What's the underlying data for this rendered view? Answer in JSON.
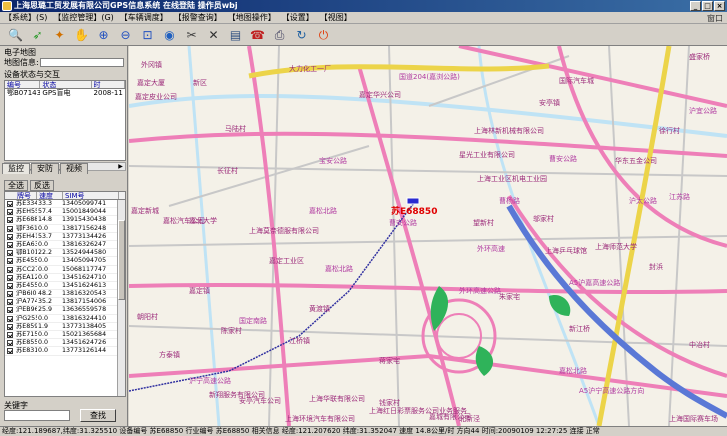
{
  "window": {
    "title": "上海思璐工贸发展有限公司GPS信息系统    在线登陆   操作员wbj"
  },
  "menu": [
    "【系统】(S)",
    "【监控管理】(G)",
    "【车辆调度】",
    "【报警查询】",
    "【地图操作】",
    "【设置】",
    "【视图】"
  ],
  "menu_right": "窗口",
  "toolbar": [
    {
      "icon": "search-icon",
      "glyph": "🔍"
    },
    {
      "icon": "pointer-icon",
      "glyph": "➶"
    },
    {
      "icon": "wand-icon",
      "glyph": "✦"
    },
    {
      "icon": "hand-icon",
      "glyph": "✋"
    },
    {
      "icon": "zoom-in-icon",
      "glyph": "⊕"
    },
    {
      "icon": "zoom-out-icon",
      "glyph": "⊖"
    },
    {
      "icon": "zoom-rect-icon",
      "glyph": "⊡"
    },
    {
      "icon": "globe-icon",
      "glyph": "◉"
    },
    {
      "icon": "measure-icon",
      "glyph": "✂"
    },
    {
      "icon": "satellite-icon",
      "glyph": "✕"
    },
    {
      "icon": "report-icon",
      "glyph": "▤"
    },
    {
      "icon": "phone-icon",
      "glyph": "☎"
    },
    {
      "icon": "printer-icon",
      "glyph": "⎙"
    },
    {
      "icon": "refresh-icon",
      "glyph": "↻"
    },
    {
      "icon": "exit-icon",
      "glyph": "⏻"
    }
  ],
  "left": {
    "e_map_label": "电子地图",
    "map_info_label": "地图信息:",
    "device_status_label": "设备状态与交互",
    "device_grid": {
      "headers": [
        "编号",
        "状态",
        "时"
      ],
      "rows": [
        [
          "鄂B07143",
          "GPS盲电",
          "2008-11"
        ]
      ]
    },
    "tabs": [
      "监控",
      "安防",
      "视频"
    ],
    "subtabs": [
      "全选",
      "反选"
    ],
    "vehicle_grid": {
      "headers": [
        "牌号",
        "速度",
        "SIM号"
      ],
      "rows": [
        [
          "苏E33436",
          "33.3",
          "13405099741"
        ],
        [
          "苏EH5549",
          "57.4",
          "15001849044"
        ],
        [
          "苏E68850",
          "14.8",
          "13915430438"
        ],
        [
          "鄂F36141",
          "0.0",
          "13817156248"
        ],
        [
          "苏EH4177",
          "53.7",
          "13773134426"
        ],
        [
          "苏EA6357",
          "0.0",
          "13816326247"
        ],
        [
          "鄂B10141",
          "22.2",
          "13524944580"
        ],
        [
          "苏E45516",
          "0.0",
          "13405094705"
        ],
        [
          "苏CC2777",
          "0.0",
          "15068117747"
        ],
        [
          "苏EA1288",
          "0.0",
          "13451624710"
        ],
        [
          "苏E45545",
          "0.0",
          "13451624613"
        ],
        [
          "沪B6I071",
          "48.2",
          "13816320543"
        ],
        [
          "沪A77438",
          "35.2",
          "13817154006"
        ],
        [
          "沪EB9689",
          "25.9",
          "13636559578"
        ],
        [
          "沪G2550",
          "0.0",
          "13816324410"
        ],
        [
          "苏E85908",
          "1.9",
          "13773138405"
        ],
        [
          "苏E71591",
          "0.0",
          "15021365684"
        ],
        [
          "苏E85583",
          "0.0",
          "13451624726"
        ],
        [
          "苏E83190",
          "0.0",
          "13773126144"
        ]
      ]
    },
    "keyword_label": "关键字",
    "search_button": "查找"
  },
  "map": {
    "vehicle_label": "苏E68850",
    "labels": [
      {
        "text": "大力化工一厂",
        "cls": ""
      },
      {
        "text": "国道204(嘉浏公路)",
        "cls": "road"
      },
      {
        "text": "外冈镇",
        "cls": ""
      },
      {
        "text": "嘉定大厦",
        "cls": ""
      },
      {
        "text": "新区",
        "cls": ""
      },
      {
        "text": "嘉定皮业公司",
        "cls": ""
      },
      {
        "text": "马陆村",
        "cls": ""
      },
      {
        "text": "嘉定华兴公司",
        "cls": ""
      },
      {
        "text": "上海林新机械有限公司",
        "cls": ""
      },
      {
        "text": "国际汽车城",
        "cls": ""
      },
      {
        "text": "安亭镇",
        "cls": ""
      },
      {
        "text": "曹安公路",
        "cls": "road"
      },
      {
        "text": "徐行村",
        "cls": ""
      },
      {
        "text": "长征村",
        "cls": ""
      },
      {
        "text": "星光工业有限公司",
        "cls": ""
      },
      {
        "text": "上海工业区机电工业园",
        "cls": ""
      },
      {
        "text": "曹杨路",
        "cls": "road"
      },
      {
        "text": "上海莫奈德服有限公司",
        "cls": ""
      },
      {
        "text": "嘉北大学",
        "cls": ""
      },
      {
        "text": "嘉定新城",
        "cls": ""
      },
      {
        "text": "嘉松北路",
        "cls": "road"
      },
      {
        "text": "嘉松汽车公司",
        "cls": ""
      },
      {
        "text": "嘉定工业区",
        "cls": ""
      },
      {
        "text": "嘉松北路",
        "cls": "road"
      },
      {
        "text": "黄渡镇",
        "cls": ""
      },
      {
        "text": "嘉定镇",
        "cls": ""
      },
      {
        "text": "朝阳村",
        "cls": ""
      },
      {
        "text": "陈家村",
        "cls": ""
      },
      {
        "text": "方泰镇",
        "cls": ""
      },
      {
        "text": "江桥镇",
        "cls": ""
      },
      {
        "text": "沪宁高速公路",
        "cls": "road"
      },
      {
        "text": "安亭汽车公司",
        "cls": ""
      },
      {
        "text": "钱家村",
        "cls": ""
      },
      {
        "text": "外环高速",
        "cls": "road"
      },
      {
        "text": "外环高速公路",
        "cls": "road"
      },
      {
        "text": "望新村",
        "cls": ""
      },
      {
        "text": "朱家宅",
        "cls": ""
      },
      {
        "text": "新江桥",
        "cls": ""
      },
      {
        "text": "中冶村",
        "cls": ""
      },
      {
        "text": "邬家村",
        "cls": ""
      },
      {
        "text": "封浜",
        "cls": ""
      },
      {
        "text": "上海乒乓球馆",
        "cls": ""
      },
      {
        "text": "上海师范大学",
        "cls": ""
      },
      {
        "text": "华东五金公司",
        "cls": ""
      },
      {
        "text": "A5沪嘉高速公路",
        "cls": "road"
      },
      {
        "text": "A5沪宁高速公路方向",
        "cls": "road"
      },
      {
        "text": "江苏路",
        "cls": "road"
      },
      {
        "text": "沪宜公路",
        "cls": "road"
      },
      {
        "text": "沪太公路",
        "cls": "road"
      },
      {
        "text": "宝安公路",
        "cls": "road"
      },
      {
        "text": "曹安公路",
        "cls": "road"
      },
      {
        "text": "新翔服务有限公司",
        "cls": ""
      },
      {
        "text": "上海环境汽车有限公司",
        "cls": ""
      },
      {
        "text": "上海华联有限公司",
        "cls": ""
      },
      {
        "text": "上海国际赛车场",
        "cls": ""
      },
      {
        "text": "蒋家宅",
        "cls": ""
      },
      {
        "text": "北新泾",
        "cls": ""
      },
      {
        "text": "嘉松北路",
        "cls": "road"
      },
      {
        "text": "上海红日彩票服务公司业务服务",
        "cls": ""
      },
      {
        "text": "国定南路",
        "cls": "road"
      },
      {
        "text": "嘉城有限公司",
        "cls": ""
      },
      {
        "text": "盛家桥",
        "cls": ""
      }
    ]
  },
  "status": {
    "text": "经度:121.189687,纬度:31.325510  设备编号 苏E68850  行业编号 苏E68850  相关信息 经度:121.207620 纬度:31.352047 速度 14.8公里/时 方向44 时间:20090109 12:27:25  连接 正常"
  }
}
